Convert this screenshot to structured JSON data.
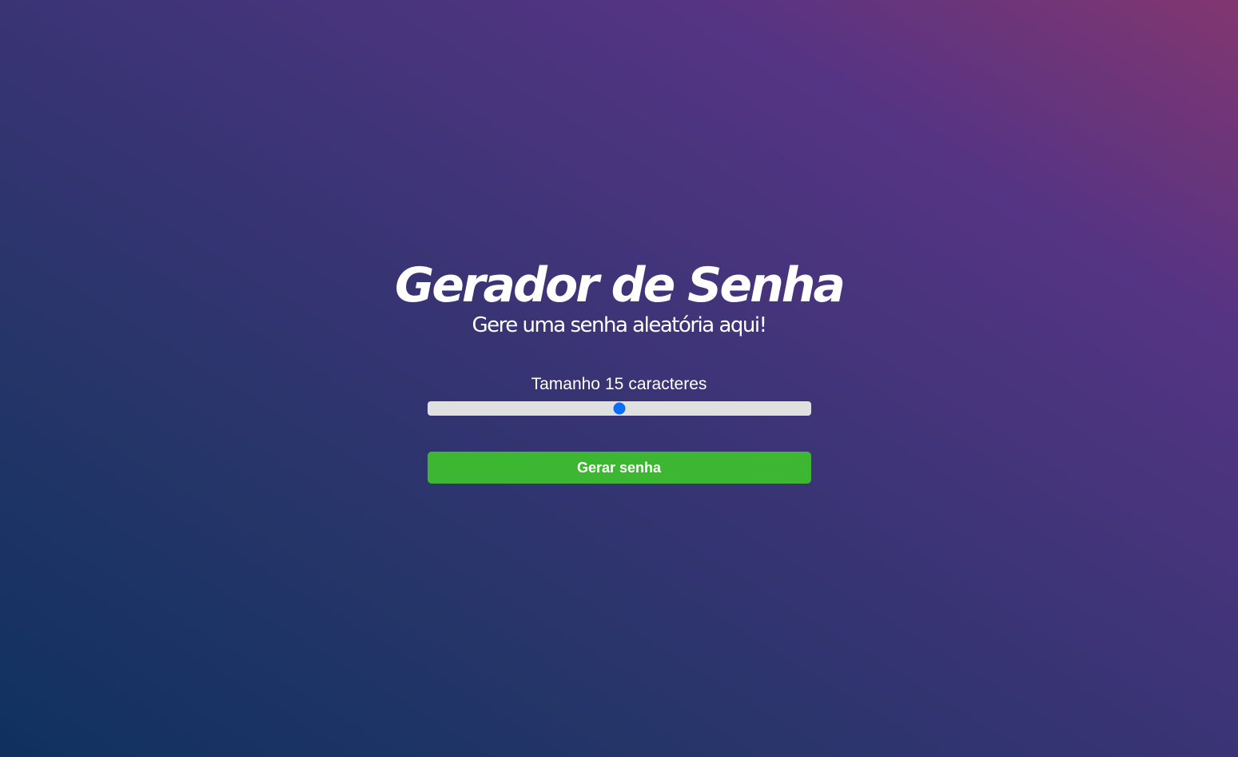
{
  "header": {
    "title": "Gerador de Senha",
    "subtitle": "Gere uma senha aleatória aqui!"
  },
  "size": {
    "label_prefix": "Tamanho",
    "value": "15",
    "label_suffix": "caracteres",
    "slider_fraction": 0.5
  },
  "actions": {
    "generate_label": "Gerar senha"
  },
  "colors": {
    "button": "#3db731",
    "slider_thumb": "#0b6ef5",
    "slider_track": "#e0e0e0"
  }
}
